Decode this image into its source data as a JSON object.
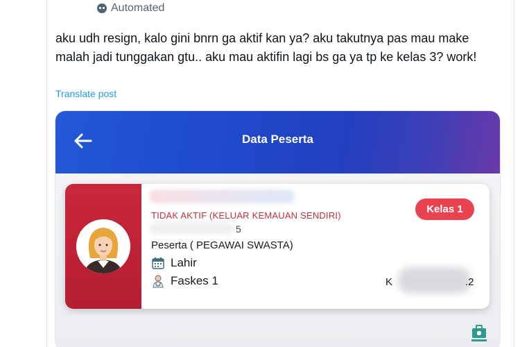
{
  "tweet": {
    "automated_label": "Automated",
    "text": "aku udh resign, kalo gini bnrn ga aktif kan ya? aku takutnya pas mau make malah jadi tunggakan gtu.. aku mau aktifin lagi bs ga ya tp ke kelas 3? work!",
    "translate_label": "Translate post"
  },
  "app": {
    "title": "Data Peserta",
    "card": {
      "status": "TIDAK AKTIF (KELUAR KEMAUAN SENDIRI)",
      "id_tail": "5",
      "class_badge": "Kelas 1",
      "participant_type": "Peserta  ( PEGAWAI SWASTA)",
      "birth_label": "Lahir",
      "facility_label": "Faskes 1",
      "region_prefix": "K",
      "region_suffix": ".2"
    }
  },
  "icons": [
    "robot-icon",
    "back-arrow-icon",
    "avatar",
    "calendar-icon",
    "doctor-icon",
    "bottom-nav-icon"
  ],
  "colors": {
    "header_gradient_start": "#2358d6",
    "header_gradient_end": "#6b3aa8",
    "card_strip": "#c9263a",
    "status_text": "#c0303e",
    "badge": "#e9434f",
    "link": "#1d9bf0"
  }
}
